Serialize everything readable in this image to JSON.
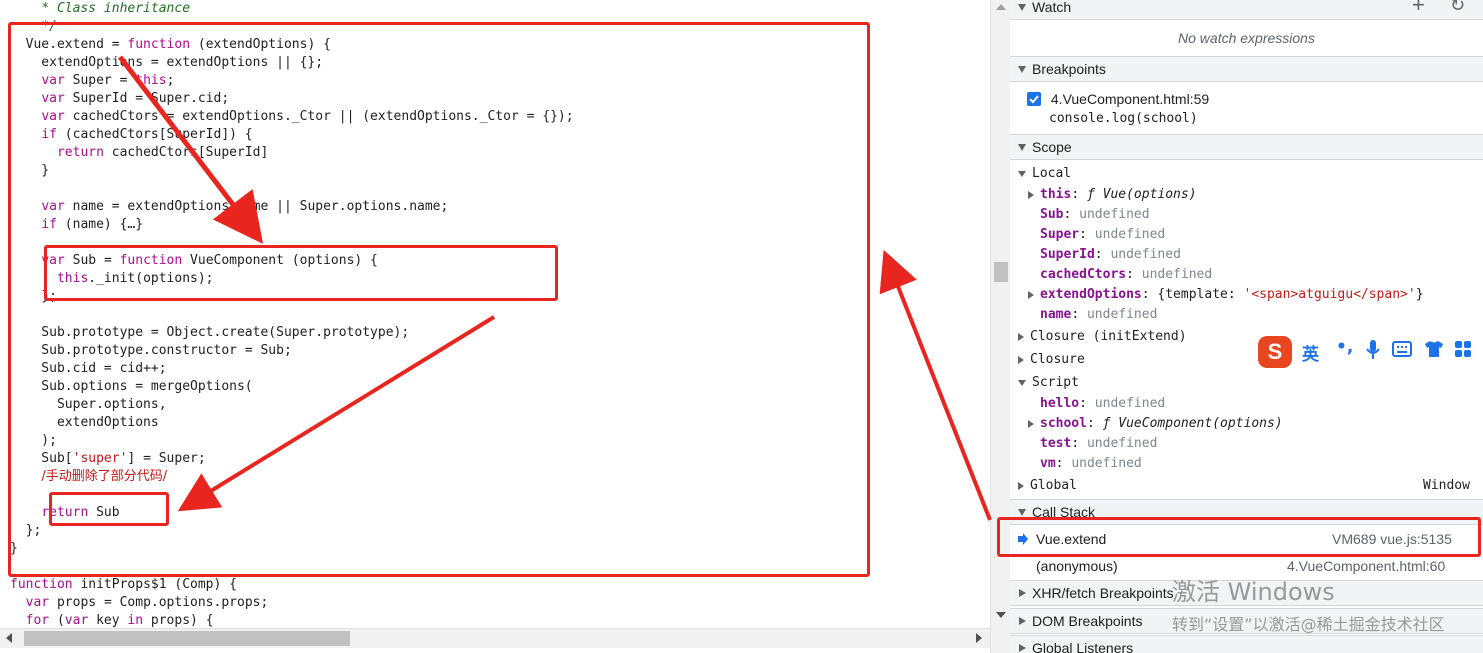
{
  "editor": {
    "code_lines": [
      [
        [
          "    ",
          ""
        ],
        [
          "* Class inheritance",
          "cm"
        ]
      ],
      [
        [
          "    ",
          ""
        ],
        [
          "*/",
          "cm"
        ]
      ],
      [
        [
          "  Vue.extend ",
          ""
        ],
        [
          "=",
          ""
        ],
        [
          " ",
          ""
        ],
        [
          "function",
          "kw"
        ],
        [
          " (",
          ""
        ],
        [
          "extendOptions",
          ""
        ],
        [
          ") {",
          ""
        ]
      ],
      [
        [
          "    extendOptions ",
          ""
        ],
        [
          "=",
          ""
        ],
        [
          " extendOptions ",
          ""
        ],
        [
          "||",
          ""
        ],
        [
          " {};",
          ""
        ]
      ],
      [
        [
          "    ",
          ""
        ],
        [
          "var",
          "kw"
        ],
        [
          " Super ",
          ""
        ],
        [
          "=",
          ""
        ],
        [
          " ",
          ""
        ],
        [
          "this",
          "kw"
        ],
        [
          ";",
          ""
        ]
      ],
      [
        [
          "    ",
          ""
        ],
        [
          "var",
          "kw"
        ],
        [
          " SuperId ",
          ""
        ],
        [
          "=",
          ""
        ],
        [
          " Super.cid;",
          ""
        ]
      ],
      [
        [
          "    ",
          ""
        ],
        [
          "var",
          "kw"
        ],
        [
          " cachedCtors ",
          ""
        ],
        [
          "=",
          ""
        ],
        [
          " extendOptions._Ctor ",
          ""
        ],
        [
          "||",
          ""
        ],
        [
          " (extendOptions._Ctor ",
          ""
        ],
        [
          "=",
          ""
        ],
        [
          " {});",
          ""
        ]
      ],
      [
        [
          "    ",
          ""
        ],
        [
          "if",
          "kw"
        ],
        [
          " (cachedCtors[SuperId]) {",
          ""
        ]
      ],
      [
        [
          "      ",
          ""
        ],
        [
          "return",
          "kw"
        ],
        [
          " cachedCtors[SuperId]",
          ""
        ]
      ],
      [
        [
          "    }",
          ""
        ]
      ],
      [
        [
          "",
          ""
        ]
      ],
      [
        [
          "    ",
          ""
        ],
        [
          "var",
          "kw"
        ],
        [
          " name ",
          ""
        ],
        [
          "=",
          ""
        ],
        [
          " extendOptions.name ",
          ""
        ],
        [
          "||",
          ""
        ],
        [
          " Super.options.name;",
          ""
        ]
      ],
      [
        [
          "    ",
          ""
        ],
        [
          "if",
          "kw"
        ],
        [
          " (name) {…}",
          ""
        ]
      ],
      [
        [
          "",
          ""
        ]
      ],
      [
        [
          "    ",
          ""
        ],
        [
          "var",
          "kw"
        ],
        [
          " Sub ",
          ""
        ],
        [
          "=",
          ""
        ],
        [
          " ",
          ""
        ],
        [
          "function",
          "kw"
        ],
        [
          " VueComponent (options) {",
          ""
        ]
      ],
      [
        [
          "      ",
          ""
        ],
        [
          "this",
          "kw"
        ],
        [
          "._init(options);",
          ""
        ]
      ],
      [
        [
          "    };",
          ""
        ]
      ],
      [
        [
          "",
          ""
        ]
      ],
      [
        [
          "    Sub.prototype ",
          ""
        ],
        [
          "=",
          ""
        ],
        [
          " Object.create(Super.prototype);",
          ""
        ]
      ],
      [
        [
          "    Sub.prototype.constructor ",
          ""
        ],
        [
          "=",
          ""
        ],
        [
          " Sub;",
          ""
        ]
      ],
      [
        [
          "    Sub.cid ",
          ""
        ],
        [
          "=",
          ""
        ],
        [
          " cid++;",
          ""
        ]
      ],
      [
        [
          "    Sub.options ",
          ""
        ],
        [
          "=",
          ""
        ],
        [
          " mergeOptions(",
          ""
        ]
      ],
      [
        [
          "      Super.options,",
          ""
        ]
      ],
      [
        [
          "      extendOptions",
          ""
        ]
      ],
      [
        [
          "    );",
          ""
        ]
      ],
      [
        [
          "    Sub[",
          ""
        ],
        [
          "'super'",
          "str"
        ],
        [
          "] ",
          ""
        ],
        [
          "=",
          ""
        ],
        [
          " Super;",
          ""
        ]
      ],
      [
        [
          "    ",
          ""
        ],
        [
          "/手动删除了部分代码/",
          "zh"
        ]
      ],
      [
        [
          "",
          ""
        ]
      ],
      [
        [
          "    ",
          ""
        ],
        [
          "return",
          "kw"
        ],
        [
          " Sub",
          ""
        ]
      ],
      [
        [
          "  };",
          ""
        ]
      ],
      [
        [
          "}",
          ""
        ]
      ],
      [
        [
          "",
          ""
        ]
      ],
      [
        [
          "",
          ""
        ],
        [
          "function",
          "kw"
        ],
        [
          " initProps$1 (Comp) {",
          ""
        ]
      ],
      [
        [
          "  ",
          ""
        ],
        [
          "var",
          "kw"
        ],
        [
          " props ",
          ""
        ],
        [
          "=",
          ""
        ],
        [
          " Comp.options.props;",
          ""
        ]
      ],
      [
        [
          "  ",
          ""
        ],
        [
          "for",
          "kw"
        ],
        [
          " (",
          ""
        ],
        [
          "var",
          "kw"
        ],
        [
          " key ",
          ""
        ],
        [
          "in",
          "kw"
        ],
        [
          " props) {",
          ""
        ]
      ]
    ]
  },
  "panel": {
    "watch": {
      "title": "Watch",
      "add_icon": "+",
      "refresh_icon": "↻",
      "empty_text": "No watch expressions"
    },
    "breakpoints": {
      "title": "Breakpoints",
      "item_file": "4.VueComponent.html:59",
      "item_code": "console.log(school)"
    },
    "scope": {
      "title": "Scope",
      "local_label": "Local",
      "local_vars": [
        {
          "name": "this",
          "value": "ƒ Vue(options)",
          "kind": "fn",
          "expandable": true
        },
        {
          "name": "Sub",
          "value": "undefined",
          "kind": "undef",
          "expandable": false
        },
        {
          "name": "Super",
          "value": "undefined",
          "kind": "undef",
          "expandable": false
        },
        {
          "name": "SuperId",
          "value": "undefined",
          "kind": "undef",
          "expandable": false
        },
        {
          "name": "cachedCtors",
          "value": "undefined",
          "kind": "undef",
          "expandable": false
        },
        {
          "name": "extendOptions",
          "value_prefix": "{template: ",
          "value_str": "'<span>atguigu</span>'",
          "value_suffix": "}",
          "kind": "obj",
          "expandable": true
        },
        {
          "name": "name",
          "value": "undefined",
          "kind": "undef",
          "expandable": false
        }
      ],
      "closure_1": "Closure (initExtend)",
      "closure_2": "Closure",
      "script_label": "Script",
      "script_vars": [
        {
          "name": "hello",
          "value": "undefined",
          "kind": "undef",
          "expandable": false
        },
        {
          "name": "school",
          "value": "ƒ VueComponent(options)",
          "kind": "fn",
          "expandable": true
        },
        {
          "name": "test",
          "value": "undefined",
          "kind": "undef",
          "expandable": false
        },
        {
          "name": "vm",
          "value": "undefined",
          "kind": "undef",
          "expandable": false
        }
      ],
      "global_label": "Global",
      "global_value": "Window"
    },
    "call_stack": {
      "title": "Call Stack",
      "frames": [
        {
          "name": "Vue.extend",
          "location": "VM689 vue.js:5135"
        },
        {
          "name": "(anonymous)",
          "location": "4.VueComponent.html:60"
        }
      ]
    },
    "xhr_title": "XHR/fetch Breakpoints",
    "dom_title": "DOM Breakpoints",
    "global_listeners_title": "Global Listeners"
  },
  "ime": {
    "logo": "S",
    "lang": "英"
  },
  "watermark": {
    "line1": "激活 Windows",
    "line2": "转到“设置”以激活@稀土掘金技术社区"
  },
  "colors": {
    "annotation_red": "#e8251f",
    "accent_blue": "#1a73e8",
    "panel_header_bg": "#f1f3f4"
  }
}
